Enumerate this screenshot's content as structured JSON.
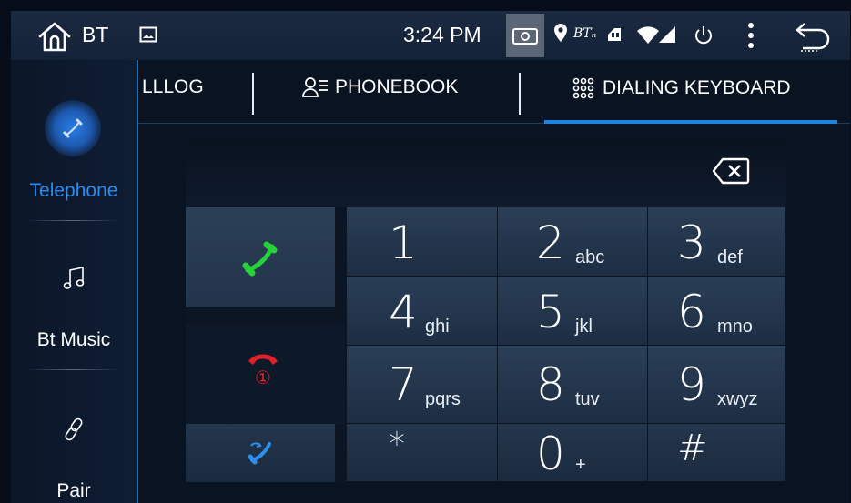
{
  "statusbar": {
    "title": "BT",
    "time": "3:24 PM",
    "icons": [
      "home-icon",
      "gallery-icon",
      "screenshot-icon",
      "location-icon",
      "bt-icon",
      "usb-icon",
      "wifi-icon",
      "signal-icon",
      "power-icon",
      "menu-icon",
      "back-icon"
    ],
    "bt_small": "BTₙ"
  },
  "sidebar": {
    "items": [
      {
        "label": "Telephone",
        "icon": "phone-icon",
        "active": true
      },
      {
        "label": "Bt Music",
        "icon": "music-icon",
        "active": false
      },
      {
        "label": "Pair",
        "icon": "link-icon",
        "active": false
      }
    ]
  },
  "tabs": [
    {
      "label": "LLLOG",
      "icon": ""
    },
    {
      "label": "PHONEBOOK",
      "icon": "contacts-icon"
    },
    {
      "label": "DIALING KEYBOARD",
      "icon": "dialpad-icon",
      "active": true
    }
  ],
  "dialer": {
    "number": "",
    "keys": [
      {
        "digit": "1",
        "letters": ""
      },
      {
        "digit": "2",
        "letters": "abc"
      },
      {
        "digit": "3",
        "letters": "def"
      },
      {
        "digit": "4",
        "letters": "ghi"
      },
      {
        "digit": "5",
        "letters": "jkl"
      },
      {
        "digit": "6",
        "letters": "mno"
      },
      {
        "digit": "7",
        "letters": "pqrs"
      },
      {
        "digit": "8",
        "letters": "tuv"
      },
      {
        "digit": "9",
        "letters": "xwyz"
      },
      {
        "digit": "*",
        "letters": ""
      },
      {
        "digit": "0",
        "letters": "+"
      },
      {
        "digit": "#",
        "letters": ""
      }
    ],
    "hangup_badge": "①"
  },
  "colors": {
    "accent": "#1f86e0",
    "call_green": "#26d23a",
    "hangup_red": "#e0202a",
    "transfer_blue": "#2d8ff0"
  }
}
